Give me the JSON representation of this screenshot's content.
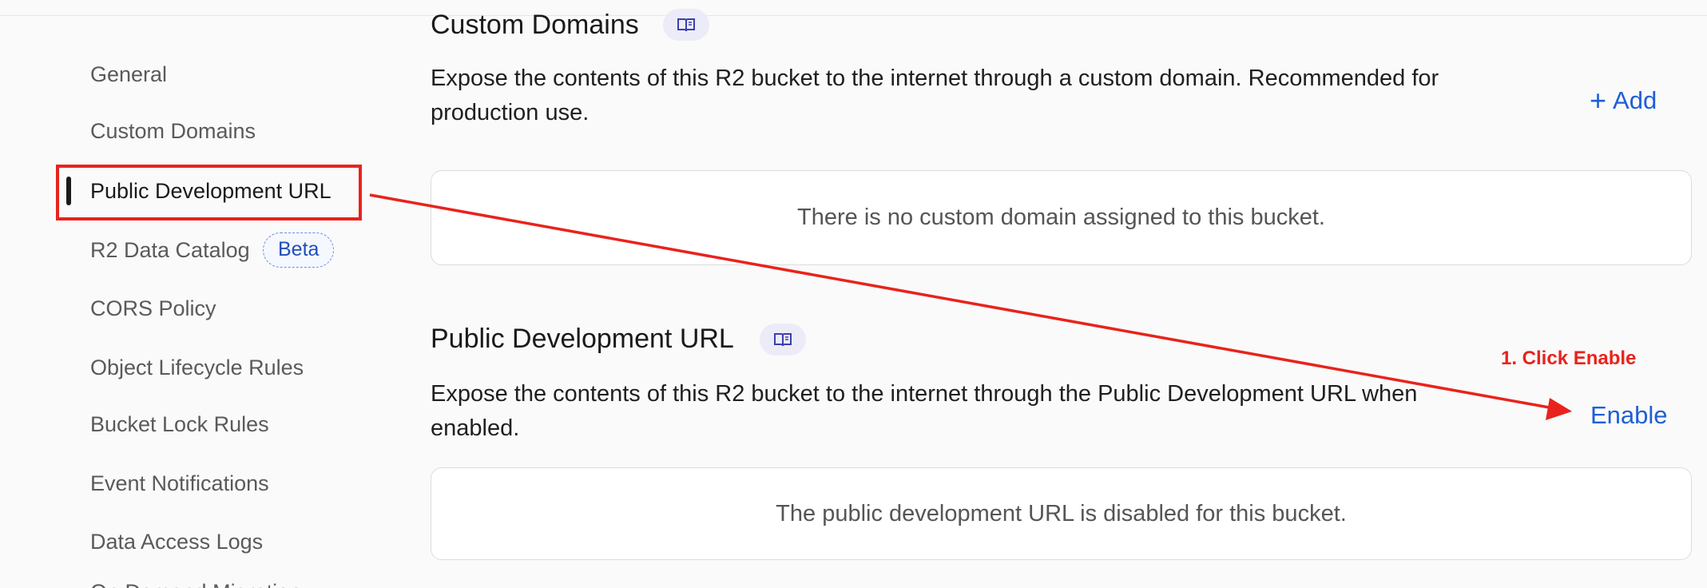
{
  "sidebar": {
    "items": [
      {
        "label": "General"
      },
      {
        "label": "Custom Domains"
      },
      {
        "label": "Public Development URL",
        "active": true
      },
      {
        "label": "R2 Data Catalog",
        "badge": "Beta"
      },
      {
        "label": "CORS Policy"
      },
      {
        "label": "Object Lifecycle Rules"
      },
      {
        "label": "Bucket Lock Rules"
      },
      {
        "label": "Event Notifications"
      },
      {
        "label": "Data Access Logs"
      },
      {
        "label": "On Demand Migration"
      }
    ]
  },
  "custom_domains": {
    "title": "Custom Domains",
    "description": "Expose the contents of this R2 bucket to the internet through a custom domain. Recommended for production use.",
    "action_label": "Add",
    "empty_message": "There is no custom domain assigned to this bucket."
  },
  "public_dev_url": {
    "title": "Public Development URL",
    "description": "Expose the contents of this R2 bucket to the internet through the Public Development URL when enabled.",
    "action_label": "Enable",
    "empty_message": "The public development URL is disabled for this bucket."
  },
  "annotation": {
    "label": "1. Click Enable",
    "color": "#e8231d"
  },
  "icons": {
    "docs": "book-icon",
    "add": "plus-icon"
  },
  "colors": {
    "accent": "#1f5fd6",
    "badge_text": "#1f4fb8"
  }
}
